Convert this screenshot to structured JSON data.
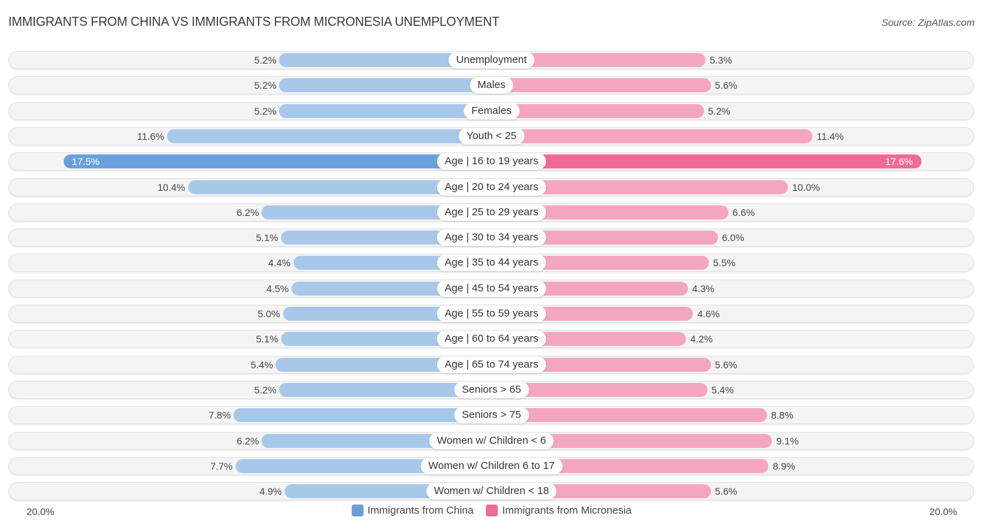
{
  "header": {
    "title": "IMMIGRANTS FROM CHINA VS IMMIGRANTS FROM MICRONESIA UNEMPLOYMENT",
    "source": "Source: ZipAtlas.com"
  },
  "colors": {
    "china": "#a8c8ea",
    "china_highlight": "#6a9fdc",
    "micronesia": "#f5a6bf",
    "micronesia_highlight": "#f06b94"
  },
  "chart_data": {
    "type": "bar",
    "orientation": "horizontal-diverging",
    "title": "IMMIGRANTS FROM CHINA VS IMMIGRANTS FROM MICRONESIA UNEMPLOYMENT",
    "xlabel": "",
    "ylabel": "",
    "xlim": [
      -20,
      20
    ],
    "axis_labels": {
      "left": "20.0%",
      "right": "20.0%"
    },
    "legend": {
      "position": "bottom-center",
      "entries": [
        "Immigrants from China",
        "Immigrants from Micronesia"
      ]
    },
    "categories": [
      "Unemployment",
      "Males",
      "Females",
      "Youth < 25",
      "Age | 16 to 19 years",
      "Age | 20 to 24 years",
      "Age | 25 to 29 years",
      "Age | 30 to 34 years",
      "Age | 35 to 44 years",
      "Age | 45 to 54 years",
      "Age | 55 to 59 years",
      "Age | 60 to 64 years",
      "Age | 65 to 74 years",
      "Seniors > 65",
      "Seniors > 75",
      "Women w/ Children < 6",
      "Women w/ Children 6 to 17",
      "Women w/ Children < 18"
    ],
    "series": [
      {
        "name": "Immigrants from China",
        "values": [
          5.2,
          5.2,
          5.2,
          11.6,
          17.5,
          10.4,
          6.2,
          5.1,
          4.4,
          4.5,
          5.0,
          5.1,
          5.4,
          5.2,
          7.8,
          6.2,
          7.7,
          4.9
        ],
        "labels": [
          "5.2%",
          "5.2%",
          "5.2%",
          "11.6%",
          "17.5%",
          "10.4%",
          "6.2%",
          "5.1%",
          "4.4%",
          "4.5%",
          "5.0%",
          "5.1%",
          "5.4%",
          "5.2%",
          "7.8%",
          "6.2%",
          "7.7%",
          "4.9%"
        ]
      },
      {
        "name": "Immigrants from Micronesia",
        "values": [
          5.3,
          5.6,
          5.2,
          11.4,
          17.6,
          10.0,
          6.6,
          6.0,
          5.5,
          4.3,
          4.6,
          4.2,
          5.6,
          5.4,
          8.8,
          9.1,
          8.9,
          5.6
        ],
        "labels": [
          "5.3%",
          "5.6%",
          "5.2%",
          "11.4%",
          "17.6%",
          "10.0%",
          "6.6%",
          "6.0%",
          "5.5%",
          "4.3%",
          "4.6%",
          "4.2%",
          "5.6%",
          "5.4%",
          "8.8%",
          "9.1%",
          "8.9%",
          "5.6%"
        ]
      }
    ],
    "highlight_index": 4
  }
}
